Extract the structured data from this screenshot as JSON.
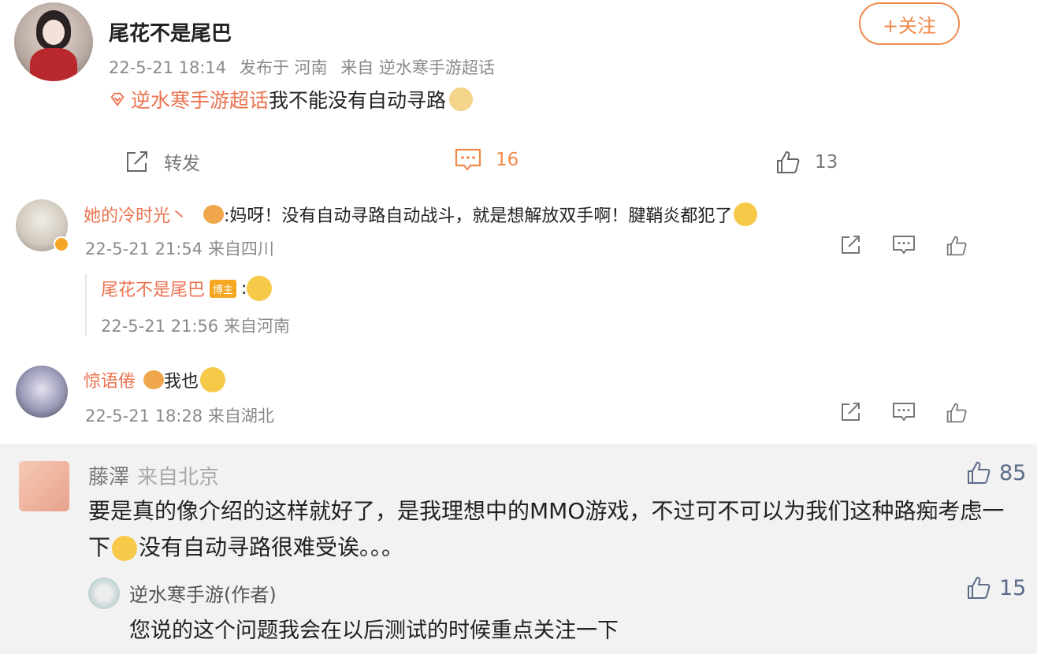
{
  "post": {
    "author": "尾花不是尾巴",
    "follow_label": "+关注",
    "meta": {
      "date": "22-5-21 18:14",
      "published": "发布于 河南",
      "source": "来自 逆水寒手游超话"
    },
    "topic": "逆水寒手游超话",
    "text": "我不能没有自动寻路",
    "actions": {
      "share_label": "转发",
      "comment_count": "16",
      "like_count": "13"
    }
  },
  "comments": [
    {
      "name": "她的冷时光丶",
      "text": ":妈呀！没有自动寻路自动战斗，就是想解放双手啊！腱鞘炎都犯了",
      "meta": "22-5-21 21:54 来自四川",
      "reply": {
        "name": "尾花不是尾巴",
        "badge": "博主",
        "text": ":",
        "meta": "22-5-21 21:56 来自河南"
      }
    },
    {
      "name": "惊语倦",
      "text": "我也",
      "meta": "22-5-21 18:28 来自湖北"
    }
  ],
  "highlight": {
    "name": "藤澤",
    "location": "来自北京",
    "like_count": "85",
    "text_part1": "要是真的像介绍的这样就好了，是我理想中的MMO游戏，不过可不可以为我们这种路痴考虑一下",
    "text_part2": "没有自动寻路很难受诶。。。",
    "reply": {
      "name": "逆水寒手游(作者)",
      "text": "您说的这个问题我会在以后测试的时候重点关注一下",
      "like_count": "15"
    }
  },
  "colors": {
    "accent": "#eb7350",
    "follow": "#f08a4b",
    "meta": "#8a8a8a",
    "highlight_bg": "#f2f2f2"
  },
  "icons": {
    "share": "share-icon",
    "comment": "comment-icon",
    "like": "thumbs-up-icon",
    "topic": "topic-diamond-icon",
    "verified": "verified-badge-icon"
  }
}
